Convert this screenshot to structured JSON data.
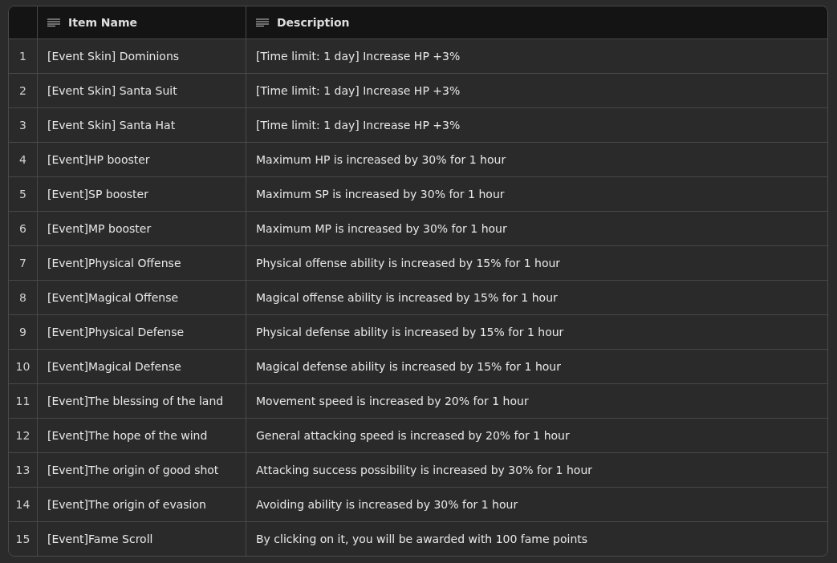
{
  "table": {
    "columns": [
      {
        "label": "Item Name"
      },
      {
        "label": "Description"
      }
    ],
    "rows": [
      {
        "index": "1",
        "name": "[Event Skin] Dominions",
        "description": "[Time limit: 1 day] Increase HP +3%"
      },
      {
        "index": "2",
        "name": "[Event Skin] Santa Suit",
        "description": "[Time limit: 1 day] Increase HP +3%"
      },
      {
        "index": "3",
        "name": "[Event Skin] Santa Hat",
        "description": "[Time limit: 1 day] Increase HP +3%"
      },
      {
        "index": "4",
        "name": "[Event]HP booster",
        "description": "Maximum HP is increased by 30% for 1 hour"
      },
      {
        "index": "5",
        "name": "[Event]SP booster",
        "description": "Maximum SP is increased by 30% for 1 hour"
      },
      {
        "index": "6",
        "name": "[Event]MP booster",
        "description": "Maximum MP is increased by 30% for 1 hour"
      },
      {
        "index": "7",
        "name": "[Event]Physical Offense",
        "description": "Physical offense ability is increased by 15% for 1 hour"
      },
      {
        "index": "8",
        "name": "[Event]Magical Offense",
        "description": "Magical offense ability is increased by 15% for 1 hour"
      },
      {
        "index": "9",
        "name": "[Event]Physical Defense",
        "description": "Physical defense ability is increased by 15% for 1 hour"
      },
      {
        "index": "10",
        "name": "[Event]Magical Defense",
        "description": "Magical defense ability is increased by 15% for 1 hour"
      },
      {
        "index": "11",
        "name": "[Event]The blessing of the land",
        "description": "Movement speed is increased by 20% for 1 hour"
      },
      {
        "index": "12",
        "name": "[Event]The hope of the wind",
        "description": "General attacking speed is increased by 20% for 1 hour"
      },
      {
        "index": "13",
        "name": "[Event]The origin of good shot",
        "description": "Attacking success possibility is increased by 30% for 1 hour"
      },
      {
        "index": "14",
        "name": "[Event]The origin of evasion",
        "description": "Avoiding ability is increased by 30% for 1 hour"
      },
      {
        "index": "15",
        "name": "[Event]Fame Scroll",
        "description": "By clicking on it, you will be awarded with 100 fame points"
      }
    ]
  }
}
